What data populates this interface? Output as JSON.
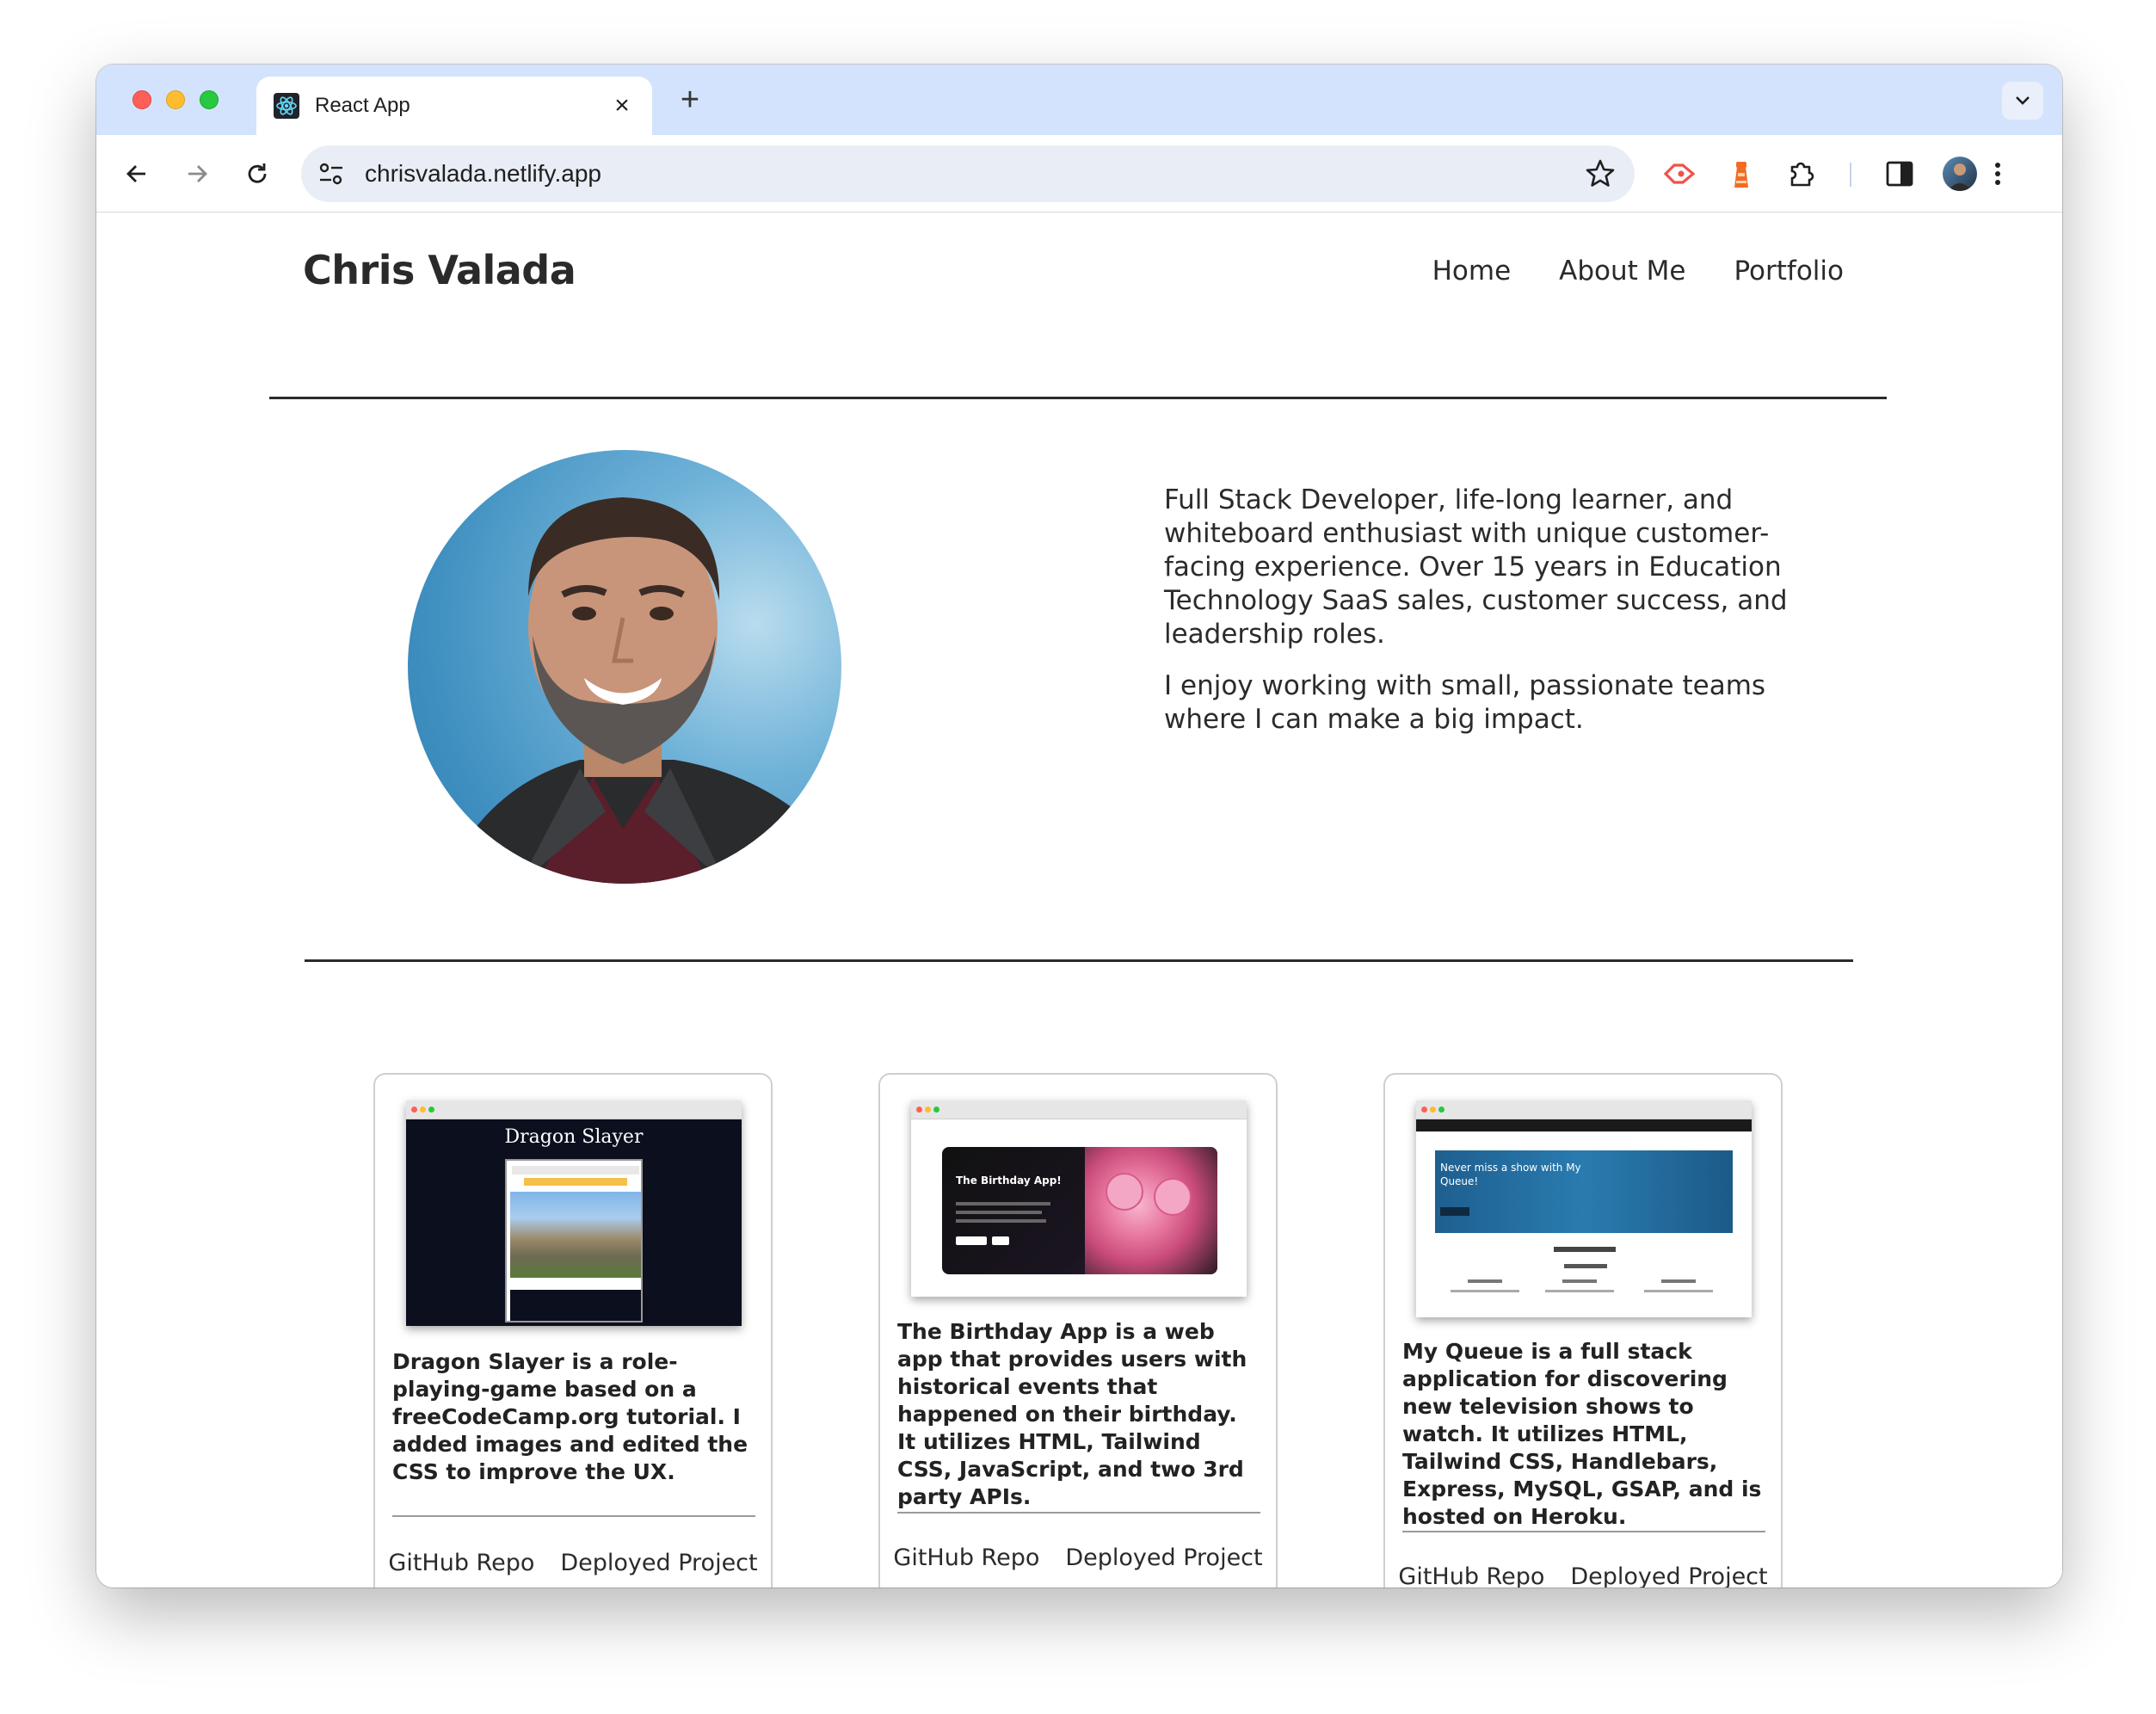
{
  "browser": {
    "tab_title": "React App",
    "url": "chrisvalada.netlify.app"
  },
  "site": {
    "name": "Chris Valada",
    "nav": [
      "Home",
      "About Me",
      "Portfolio"
    ]
  },
  "bio": {
    "paragraph1": "Full Stack Developer, life-long learner, and whiteboard enthusiast with unique customer-facing experience. Over 15 years in Education Technology SaaS sales, customer success, and leadership roles.",
    "paragraph2": "I enjoy working with small, passionate teams where I can make a big impact."
  },
  "projects": [
    {
      "thumb_title": "Dragon Slayer",
      "description": "Dragon Slayer is a role-playing-game based on a freeCodeCamp.org tutorial. I added images and edited the CSS to improve the UX.",
      "repo_label": "GitHub Repo",
      "deploy_label": "Deployed Project"
    },
    {
      "thumb_title": "The Birthday App!",
      "description": "The Birthday App is a web app that provides users with historical events that happened on their birthday. It utilizes HTML, Tailwind CSS, JavaScript, and two 3rd party APIs.",
      "repo_label": "GitHub Repo",
      "deploy_label": "Deployed Project"
    },
    {
      "thumb_title": "Never miss a show with My Queue!",
      "description": "My Queue is a full stack application for discovering new television shows to watch. It utilizes HTML, Tailwind CSS, Handlebars, Express, MySQL, GSAP, and is hosted on Heroku.",
      "repo_label": "GitHub Repo",
      "deploy_label": "Deployed Project"
    }
  ]
}
